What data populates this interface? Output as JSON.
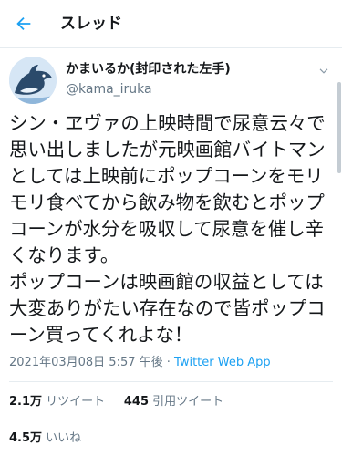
{
  "header": {
    "title": "スレッド",
    "back_icon": "arrow-left-icon"
  },
  "author": {
    "display_name": "かまいるか(封印された左手)",
    "handle": "@kama_iruka",
    "more_icon": "chevron-down-icon"
  },
  "tweet": {
    "text": "シン・ヱヴァの上映時間で尿意云々で思い出しましたが元映画館バイトマンとしては上映前にポップコーンをモリモリ食べてから飲み物を飲むとポップコーンが水分を吸収して尿意を催し辛くなります。\nポップコーンは映画館の収益としては大変ありがたい存在なので皆ポップコーン買ってくれよな！",
    "timestamp": "2021年03月08日 5:57 午後",
    "separator": " · ",
    "source": "Twitter Web App"
  },
  "stats": {
    "retweets_count": "2.1万",
    "retweets_label": "リツイート",
    "quotes_count": "445",
    "quotes_label": "引用ツイート",
    "likes_count": "4.5万",
    "likes_label": "いいね"
  },
  "colors": {
    "accent": "#1da1f2",
    "secondary_text": "#657786",
    "divider": "#e6ecf0"
  }
}
